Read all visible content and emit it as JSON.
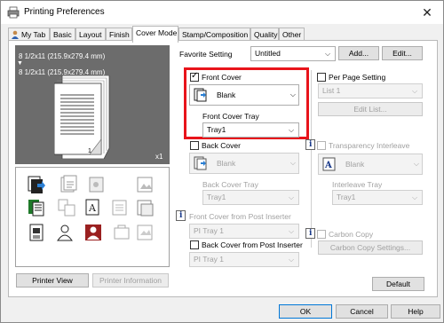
{
  "window": {
    "title": "Printing Preferences",
    "close_glyph": "✕"
  },
  "tabs": [
    {
      "label": "My Tab",
      "active": false
    },
    {
      "label": "Basic",
      "active": false
    },
    {
      "label": "Layout",
      "active": false
    },
    {
      "label": "Finish",
      "active": false
    },
    {
      "label": "Cover Mode",
      "active": true
    },
    {
      "label": "Stamp/Composition",
      "active": false
    },
    {
      "label": "Quality",
      "active": false
    },
    {
      "label": "Other",
      "active": false
    }
  ],
  "preview": {
    "paper_line_1": "8 1/2x11 (215.9x279.4 mm)",
    "paper_line_2": "8 1/2x11 (215.9x279.4 mm)",
    "page_count": "x1",
    "page_marker": "1"
  },
  "preview_buttons": {
    "printer_view": "Printer View",
    "printer_information": "Printer Information"
  },
  "favorite": {
    "label": "Favorite Setting",
    "value": "Untitled",
    "add_button": "Add...",
    "edit_button": "Edit..."
  },
  "front_cover": {
    "label": "Front Cover",
    "checked": true,
    "value": "Blank",
    "tray_label": "Front Cover Tray",
    "tray_value": "Tray1"
  },
  "back_cover": {
    "label": "Back Cover",
    "checked": false,
    "value": "Blank",
    "tray_label": "Back Cover Tray",
    "tray_value": "Tray1"
  },
  "front_cover_post_inserter": {
    "label": "Front Cover from Post Inserter",
    "value": "PI Tray 1"
  },
  "back_cover_post_inserter": {
    "label": "Back Cover from Post Inserter",
    "checked": false,
    "value": "PI Tray 1"
  },
  "per_page": {
    "label": "Per Page Setting",
    "checked": false,
    "list_value": "List 1",
    "edit_list_button": "Edit List..."
  },
  "transparency": {
    "label": "Transparency Interleave",
    "checked": false,
    "value": "Blank",
    "tray_label": "Interleave Tray",
    "tray_value": "Tray1"
  },
  "carbon_copy": {
    "label": "Carbon Copy",
    "checked": false,
    "settings_button": "Carbon Copy Settings..."
  },
  "default_button": "Default",
  "dialog_buttons": {
    "ok": "OK",
    "cancel": "Cancel",
    "help": "Help"
  },
  "colors": {
    "highlight": "#e8141b",
    "accent_blue": "#0078d7"
  }
}
